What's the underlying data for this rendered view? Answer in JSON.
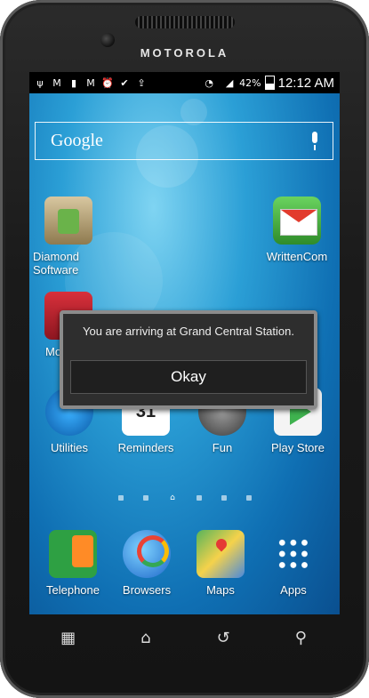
{
  "device": {
    "brand": "MOTOROLA"
  },
  "status_bar": {
    "icons": [
      "usb-icon",
      "gmail-icon",
      "signal-bars-icon",
      "gmail-icon",
      "alarm-icon",
      "check-task-icon",
      "upload-icon",
      "wifi-icon",
      "cellular-signal-icon"
    ],
    "battery_percent": "42%",
    "time": "12:12 AM"
  },
  "search": {
    "label": "Google"
  },
  "home_icons": [
    {
      "label": "Diamond\nSoftware"
    },
    {
      "label": "WrittenCom"
    },
    {
      "label": "Mo"
    },
    {
      "label": "Utilities"
    },
    {
      "label": "Reminders",
      "calendar_day": "31"
    },
    {
      "label": "Fun"
    },
    {
      "label": "Play Store"
    }
  ],
  "dock": [
    {
      "label": "Telephone"
    },
    {
      "label": "Browsers"
    },
    {
      "label": "Maps"
    },
    {
      "label": "Apps"
    }
  ],
  "dialog": {
    "message": "You are arriving at Grand Central Station.",
    "button": "Okay"
  },
  "nav": [
    "recent-apps-icon",
    "home-icon",
    "back-icon",
    "search-icon"
  ]
}
